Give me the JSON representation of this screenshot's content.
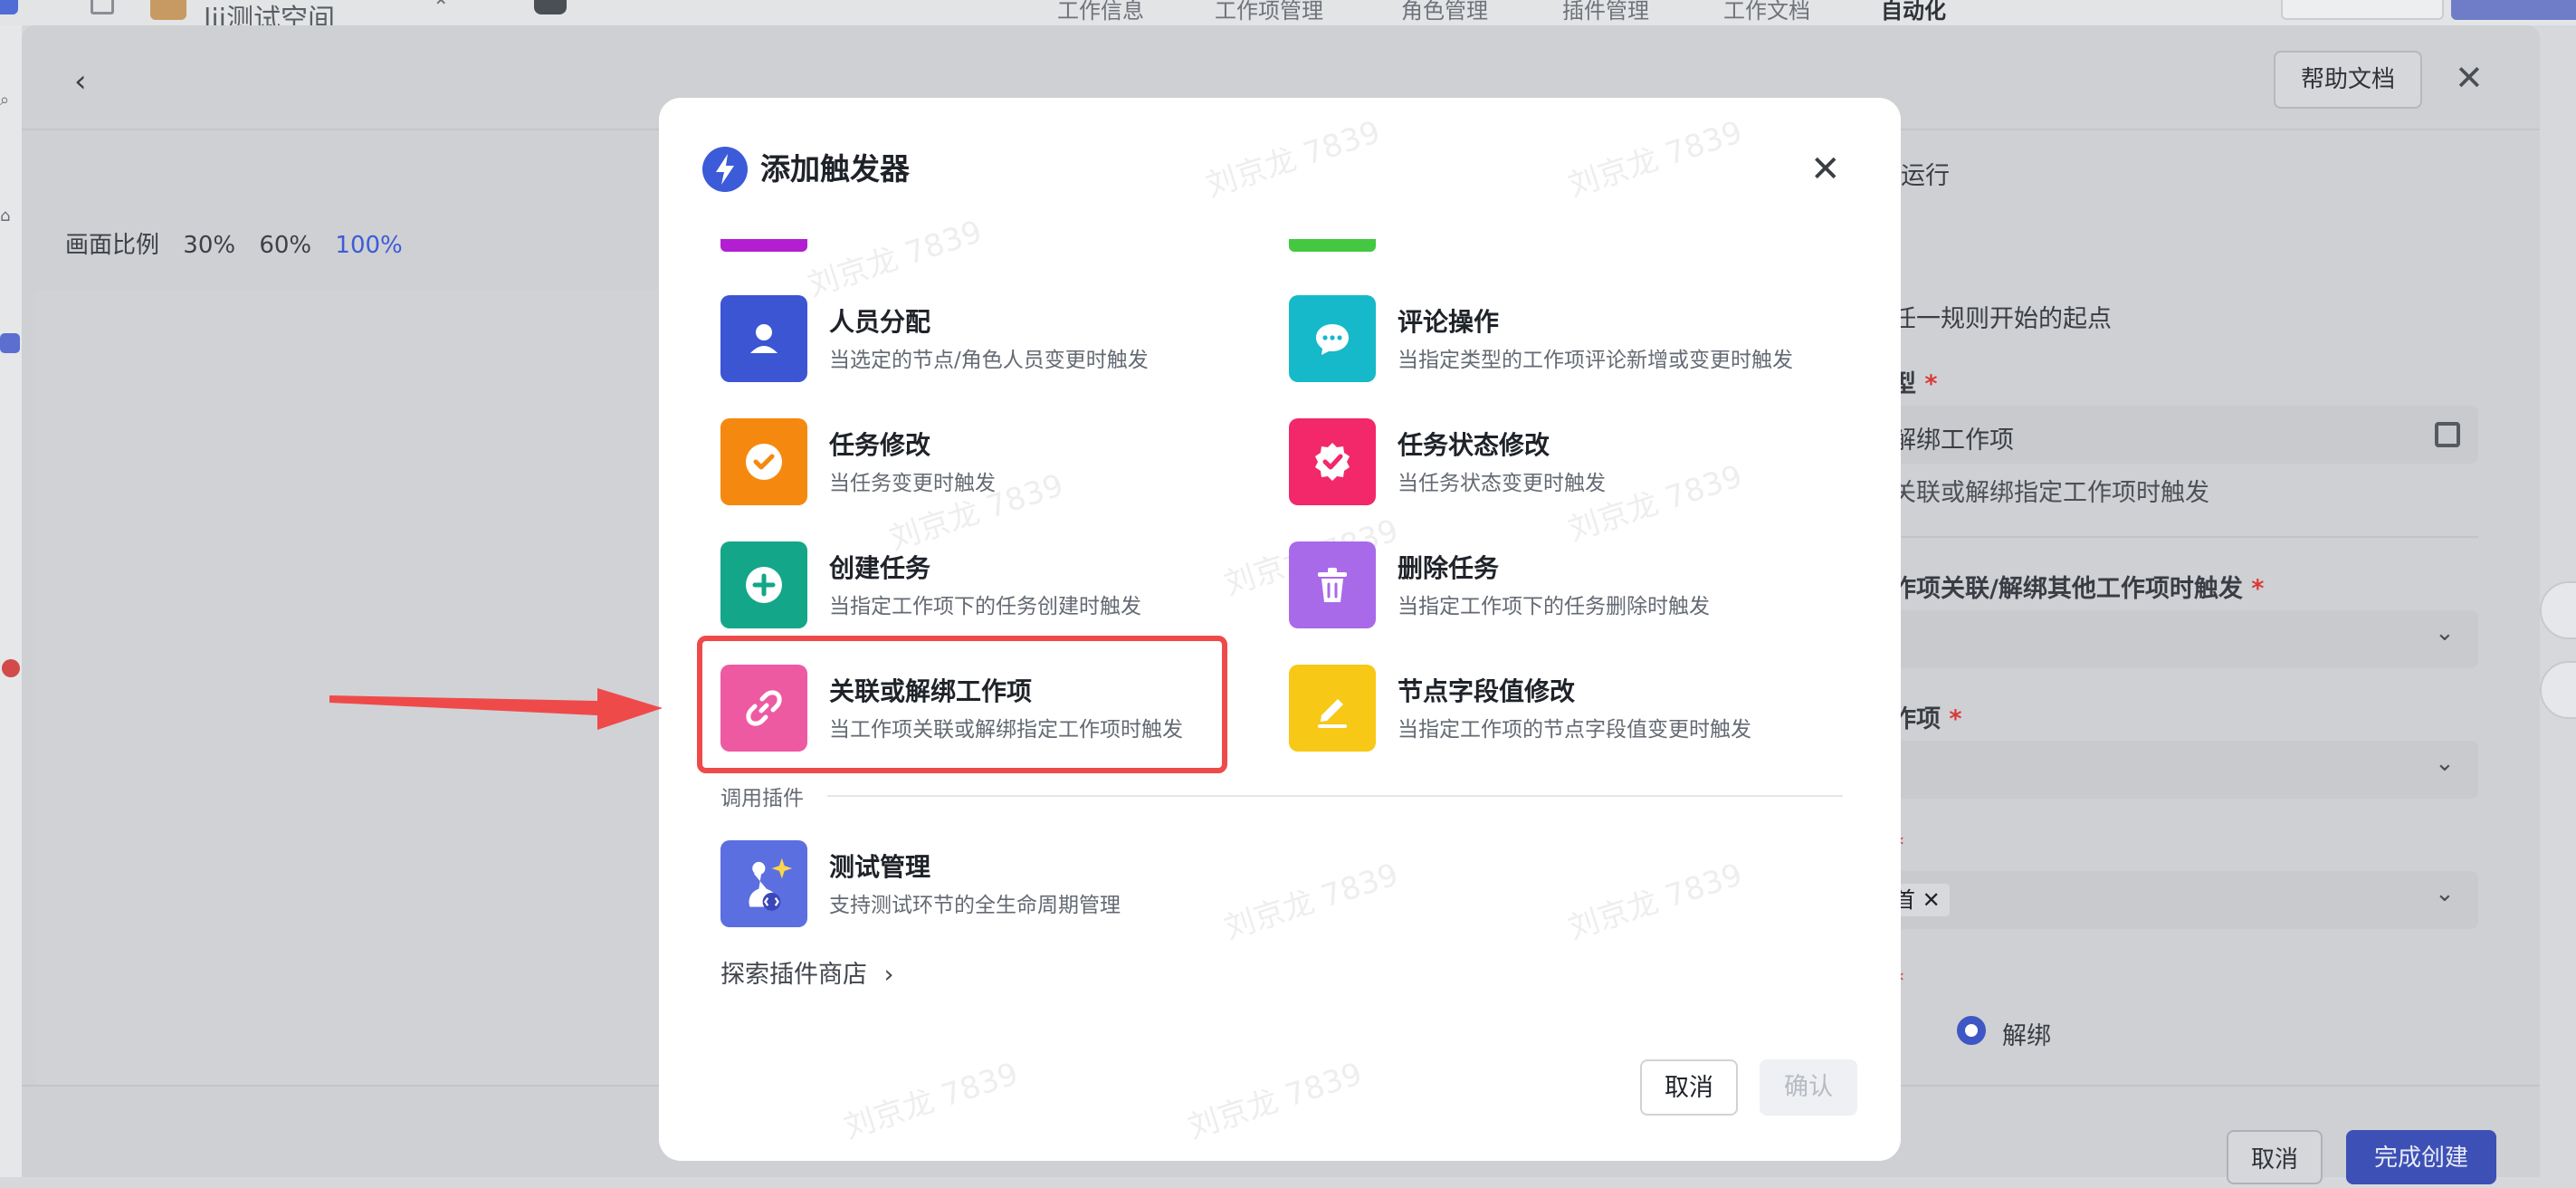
{
  "background": {
    "workspace_name": "lji测试空间",
    "top_tabs": [
      "工作信息",
      "工作项管理",
      "角色管理",
      "插件管理",
      "工作文档",
      "自动化"
    ],
    "help_button": "帮助文档",
    "ratio": {
      "label": "画面比例",
      "options": [
        "30%",
        "60%",
        "100%"
      ],
      "active": "100%"
    },
    "right_panel": {
      "tab_partial": "运行",
      "hint": "任一规则开始的起点",
      "type_label": "型",
      "type_value": "解绑工作项",
      "type_desc": "关联或解绑指定工作项时触发",
      "relate_label": "作项关联/解绑其他工作项时触发",
      "item_label": "作项",
      "tag_text": "首",
      "radio_label": "解绑"
    },
    "footer": {
      "cancel": "取消",
      "done": "完成创建"
    }
  },
  "modal": {
    "title": "添加触发器",
    "items": [
      {
        "title": "人员分配",
        "desc": "当选定的节点/角色人员变更时触发",
        "icon": "person-icon",
        "color": "#3b55d3"
      },
      {
        "title": "评论操作",
        "desc": "当指定类型的工作项评论新增或变更时触发",
        "icon": "comment-icon",
        "color": "#16b9c9"
      },
      {
        "title": "任务修改",
        "desc": "当任务变更时触发",
        "icon": "check-circle-icon",
        "color": "#f5890f"
      },
      {
        "title": "任务状态修改",
        "desc": "当任务状态变更时触发",
        "icon": "verified-badge-icon",
        "color": "#f2286a"
      },
      {
        "title": "创建任务",
        "desc": "当指定工作项下的任务创建时触发",
        "icon": "plus-circle-icon",
        "color": "#14a689"
      },
      {
        "title": "删除任务",
        "desc": "当指定工作项下的任务删除时触发",
        "icon": "trash-icon",
        "color": "#a86ae9"
      },
      {
        "title": "关联或解绑工作项",
        "desc": "当工作项关联或解绑指定工作项时触发",
        "icon": "link-icon",
        "color": "#ee5aa2"
      },
      {
        "title": "节点字段值修改",
        "desc": "当指定工作项的节点字段值变更时触发",
        "icon": "edit-icon",
        "color": "#f7c816"
      }
    ],
    "plugin_section": "调用插件",
    "plugin": {
      "title": "测试管理",
      "desc": "支持测试环节的全生命周期管理",
      "icon": "test-plugin-icon",
      "color": "#5b6fe0"
    },
    "explore_link": "探索插件商店",
    "cancel": "取消",
    "confirm": "确认",
    "watermark": "刘京龙 7839"
  }
}
